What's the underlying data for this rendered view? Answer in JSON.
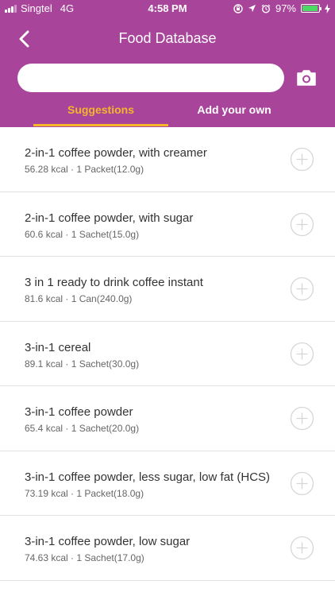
{
  "status_bar": {
    "carrier": "Singtel",
    "network": "4G",
    "time": "4:58 PM",
    "battery_percent": "97%",
    "battery_level": 0.97,
    "icons": [
      "signal-icon",
      "screen-lock-icon",
      "location-icon",
      "alarm-icon",
      "battery-icon",
      "charging-icon"
    ]
  },
  "header": {
    "title": "Food Database",
    "back_icon": "chevron-left-icon",
    "camera_icon": "camera-icon"
  },
  "search": {
    "value": "",
    "placeholder": ""
  },
  "tabs": [
    {
      "label": "Suggestions",
      "active": true
    },
    {
      "label": "Add your own",
      "active": false
    }
  ],
  "colors": {
    "header_bg": "#a8449a",
    "active_tab": "#f5b52b",
    "battery_fill": "#4cd964"
  },
  "foods": [
    {
      "name": "2-in-1 coffee powder, with creamer",
      "detail": "56.28 kcal · 1 Packet(12.0g)"
    },
    {
      "name": "2-in-1 coffee powder, with sugar",
      "detail": "60.6 kcal · 1 Sachet(15.0g)"
    },
    {
      "name": "3 in 1 ready to drink coffee instant",
      "detail": "81.6 kcal · 1 Can(240.0g)"
    },
    {
      "name": "3-in-1 cereal",
      "detail": "89.1 kcal · 1 Sachet(30.0g)"
    },
    {
      "name": "3-in-1 coffee powder",
      "detail": "65.4 kcal · 1 Sachet(20.0g)"
    },
    {
      "name": "3-in-1 coffee powder, less sugar, low fat (HCS)",
      "detail": "73.19 kcal · 1 Packet(18.0g)"
    },
    {
      "name": "3-in-1 coffee powder, low sugar",
      "detail": "74.63 kcal · 1 Sachet(17.0g)"
    }
  ]
}
